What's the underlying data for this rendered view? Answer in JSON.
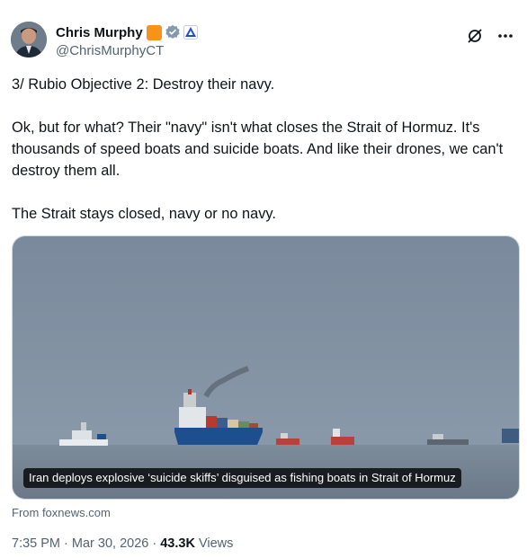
{
  "author": {
    "display_name": "Chris Murphy",
    "handle": "@ChrisMurphyCT",
    "avatar_icon": "avatar-photo",
    "badges": [
      "orange-square-badge",
      "verified-badge-icon",
      "affiliate-badge-icon"
    ]
  },
  "actions": {
    "grok_icon": "grok-icon",
    "more_icon": "more-options-icon"
  },
  "tweet": {
    "line1": "3/ Rubio Objective 2: Destroy their navy.",
    "line2": "Ok, but for what? Their \"navy\" isn't what closes the Strait of Hormuz. It's thousands of speed boats and suicide boats. And like their drones, we can't destroy them all.",
    "line3": "The Strait stays closed, navy or no navy."
  },
  "media": {
    "caption": "Iran deploys explosive ‘suicide skiffs’ disguised as fishing boats in Strait of Hormuz",
    "source": "From foxnews.com"
  },
  "meta": {
    "time_date": "7:35 PM · Mar 30, 2026 · ",
    "views_count": "43.3K",
    "views_label": " Views"
  },
  "colors": {
    "text": "#0f1419",
    "secondary": "#536471",
    "verified": "#829aab",
    "orange_badge": "#f7931a"
  }
}
